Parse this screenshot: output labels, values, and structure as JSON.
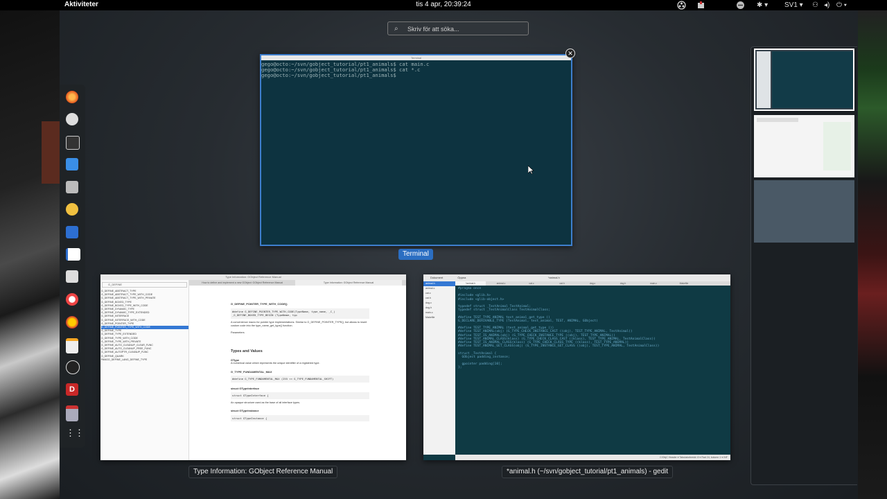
{
  "topbar": {
    "activities": "Aktiviteter",
    "clock": "tis  4 apr, 20:39:24",
    "keyboard_layout": "SV1"
  },
  "search": {
    "placeholder": "Skriv för att söka..."
  },
  "windows": {
    "terminal": {
      "title": "Terminal",
      "lines": [
        "gego@octo:~/svn/gobject_tutorial/pt1_animals$ cat main.c",
        "gego@octo:~/svn/gobject_tutorial/pt1_animals$ cat *.c",
        "gego@octo:~/svn/gobject_tutorial/pt1_animals$ "
      ]
    },
    "docs": {
      "title": "Type Information: GObject Reference Manual",
      "search_text": "G_DEFINE",
      "tabs": [
        "How to define and implement a new GObject: GObject Reference Manual",
        "Type Information: GObject Reference Manual"
      ],
      "list": [
        "G_DEFINE_ABSTRACT_TYPE",
        "G_DEFINE_ABSTRACT_TYPE_WITH_CODE",
        "G_DEFINE_ABSTRACT_TYPE_WITH_PRIVATE",
        "G_DEFINE_BOXED_TYPE",
        "G_DEFINE_BOXED_TYPE_WITH_CODE",
        "G_DEFINE_DYNAMIC_TYPE",
        "G_DEFINE_DYNAMIC_TYPE_EXTENDED",
        "G_DEFINE_INTERFACE",
        "G_DEFINE_INTERFACE_WITH_CODE",
        "G_DEFINE_POINTER_TYPE",
        "G_DEFINE_POINTER_TYPE_WITH_CODE",
        "G_DEFINE_TYPE",
        "G_DEFINE_TYPE_EXTENDED",
        "G_DEFINE_TYPE_WITH_CODE",
        "G_DEFINE_TYPE_WITH_PRIVATE",
        "G_DEFINE_AUTO_CLEANUP_CLEAR_FUNC",
        "G_DEFINE_AUTO_CLEANUP_FREE_FUNC",
        "G_DEFINE_AUTOPTR_CLEANUP_FUNC",
        "G_DEFINE_QUARK",
        "PANGO_DEFINE_LANG_DEFINE_TYPE"
      ],
      "selected_index": 10,
      "content": {
        "heading1": "G_DEFINE_POINTER_TYPE_WITH_CODE()",
        "code1": "#define G_DEFINE_POINTER_TYPE_WITH_CODE(TypeName, type_name, _C_) _G_DEFINE_BOXED_TYPE_BEGIN (TypeName, typ",
        "desc1": "A convenience macro for pointer type implementations. Similar to G_DEFINE_POINTER_TYPE(), but allows to insert custom code into the type_name_get_type() function.",
        "params_label": "Parameters",
        "section": "Types and Values",
        "gtype": "GType",
        "gtype_desc": "A numerical value which represents the unique identifier of a registered type.",
        "fund_max": "G_TYPE_FUNDAMENTAL_MAX",
        "fund_code": "#define G_TYPE_FUNDAMENTAL_MAX   (255 << G_TYPE_FUNDAMENTAL_SHIFT)",
        "iface": "struct GTypeInterface",
        "iface_code": "struct GTypeInterface {",
        "iface_desc": "An opaque structure used as the base of all interface types.",
        "instance": "struct GTypeInstance",
        "instance_code": "struct GTypeInstance {"
      }
    },
    "gedit": {
      "title": "*animal.h (~/svn/gobject_tutorial/pt1_animals) - gedit",
      "header_left": "Dokument",
      "header_open": "Öppna",
      "header_title": "*animal.h",
      "files": [
        "animal.h",
        "animal.c",
        "cat.c",
        "cat.h",
        "dog.c",
        "dog.h",
        "main.c",
        "Makefile"
      ],
      "tabs": [
        "*animal.h",
        "animal.c",
        "cat.c",
        "cat.h",
        "dog.c",
        "dog.h",
        "main.c",
        "Makefile"
      ],
      "code": [
        "#pragma once",
        "",
        "#include <glib.h>",
        "#include <glib-object.h>",
        "",
        "typedef struct _TestAnimal TestAnimal;",
        "typedef struct _TestAnimalClass TestAnimalClass;",
        "",
        "#define TEST_TYPE_ANIMAL test_animal_get_type ()",
        "G_DECLARE_DERIVABLE_TYPE (TestAnimal, test_animal, TEST, ANIMAL, GObject)",
        "",
        "#define TEST_TYPE_ANIMAL (test_animal_get_type ())",
        "#define TEST_ANIMAL(obj) (G_TYPE_CHECK_INSTANCE_CAST ((obj), TEST_TYPE_ANIMAL, TestAnimal))",
        "#define TEST_IS_ANIMAL(obj) (G_TYPE_CHECK_INSTANCE_TYPE ((obj), TEST_TYPE_ANIMAL))",
        "#define TEST_ANIMAL_CLASS(klass) (G_TYPE_CHECK_CLASS_CAST ((klass), TEST_TYPE_ANIMAL, TestAnimalClass))",
        "#define TEST_IS_ANIMAL_CLASS(klass) (G_TYPE_CHECK_CLASS_TYPE ((klass), TEST_TYPE_ANIMAL))",
        "#define TEST_ANIMAL_GET_CLASS(obj) (G_TYPE_INSTANCE_GET_CLASS ((obj), TEST_TYPE_ANIMAL, TestAnimalClass))",
        "",
        "struct _TestAnimal {",
        "  GObject padding_instance;",
        "",
        "  gpointer padding[10];",
        "};"
      ],
      "status": "C/ObjC Header  ▾   Tabulatorbredd: 8  ▾   Rad 24, kolumn 1  ▾   INF"
    }
  },
  "labels": {
    "terminal": "Terminal",
    "docs": "Type Information: GObject Reference Manual",
    "gedit": "*animal.h (~/svn/gobject_tutorial/pt1_animals) - gedit"
  },
  "dash_icons": [
    "firefox-icon",
    "weather-icon",
    "system-monitor-icon",
    "chat-icon",
    "screenshot-icon",
    "rhythmbox-icon",
    "screen-icon",
    "document-viewer-icon",
    "files-icon",
    "help-icon",
    "software-icon",
    "notes-icon",
    "obs-icon",
    "calendar-d-icon",
    "installer-icon",
    "show-apps-icon"
  ],
  "colors": {
    "accent": "#2b6ec2",
    "terminal_bg": "#0d3340"
  }
}
